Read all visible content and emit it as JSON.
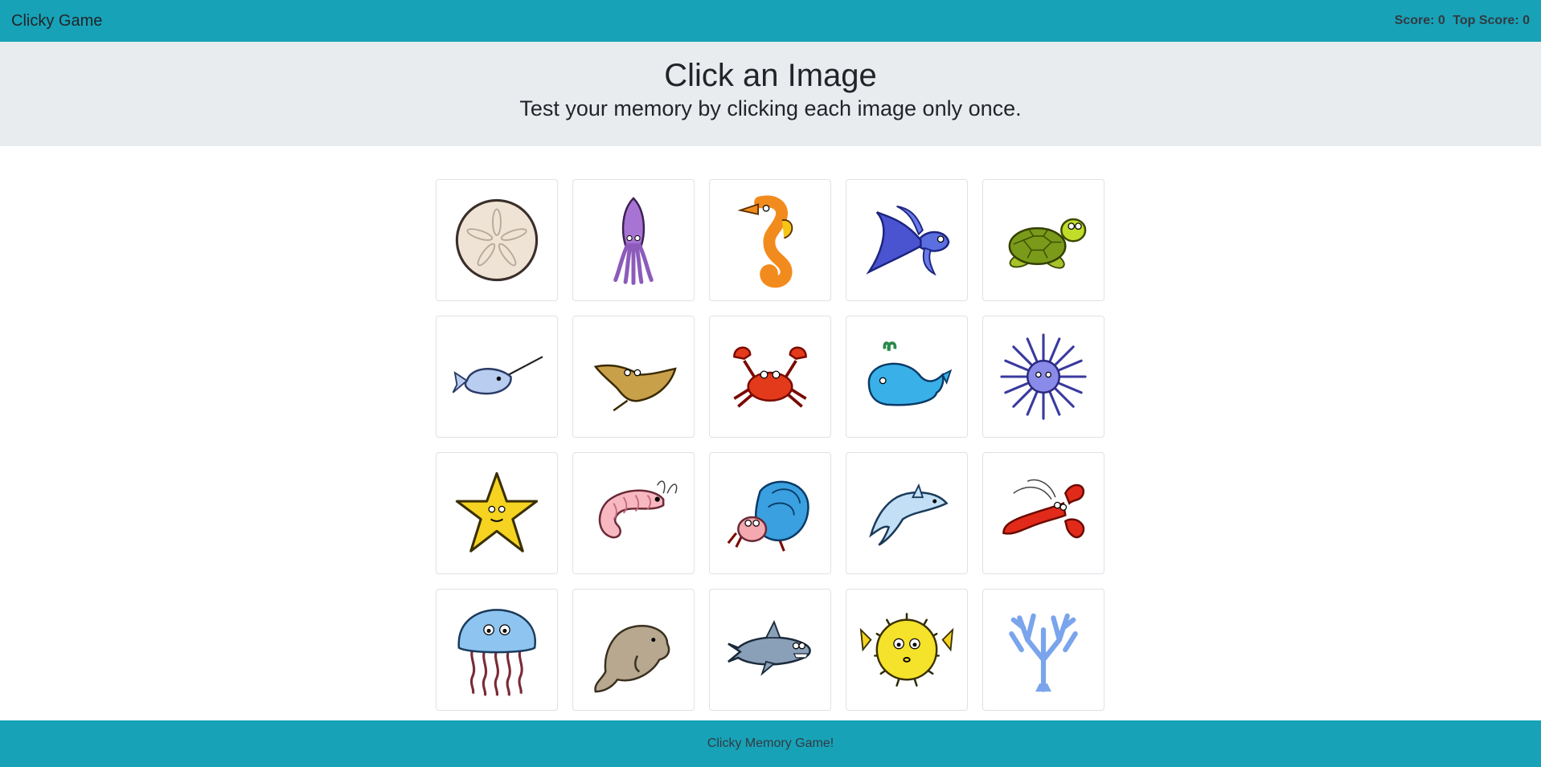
{
  "navbar": {
    "brand": "Clicky Game",
    "score_label": "Score: 0",
    "top_score_label": "Top Score: 0"
  },
  "header": {
    "title": "Click an Image",
    "subtitle": "Test your memory by clicking each image only once."
  },
  "cards": [
    {
      "icon": "sand-dollar-icon"
    },
    {
      "icon": "squid-icon"
    },
    {
      "icon": "seahorse-icon"
    },
    {
      "icon": "betta-fish-icon"
    },
    {
      "icon": "sea-turtle-icon"
    },
    {
      "icon": "narwhal-icon"
    },
    {
      "icon": "manta-ray-icon"
    },
    {
      "icon": "crab-icon"
    },
    {
      "icon": "whale-icon"
    },
    {
      "icon": "sea-urchin-icon"
    },
    {
      "icon": "starfish-icon"
    },
    {
      "icon": "shrimp-icon"
    },
    {
      "icon": "hermit-crab-icon"
    },
    {
      "icon": "dolphin-icon"
    },
    {
      "icon": "lobster-icon"
    },
    {
      "icon": "jellyfish-icon"
    },
    {
      "icon": "manatee-icon"
    },
    {
      "icon": "shark-icon"
    },
    {
      "icon": "pufferfish-icon"
    },
    {
      "icon": "coral-icon"
    }
  ],
  "footer": {
    "text": "Clicky Memory Game!"
  },
  "colors": {
    "accent": "#17a2b8",
    "jumbotron": "#e9ecef",
    "text": "#212529"
  }
}
